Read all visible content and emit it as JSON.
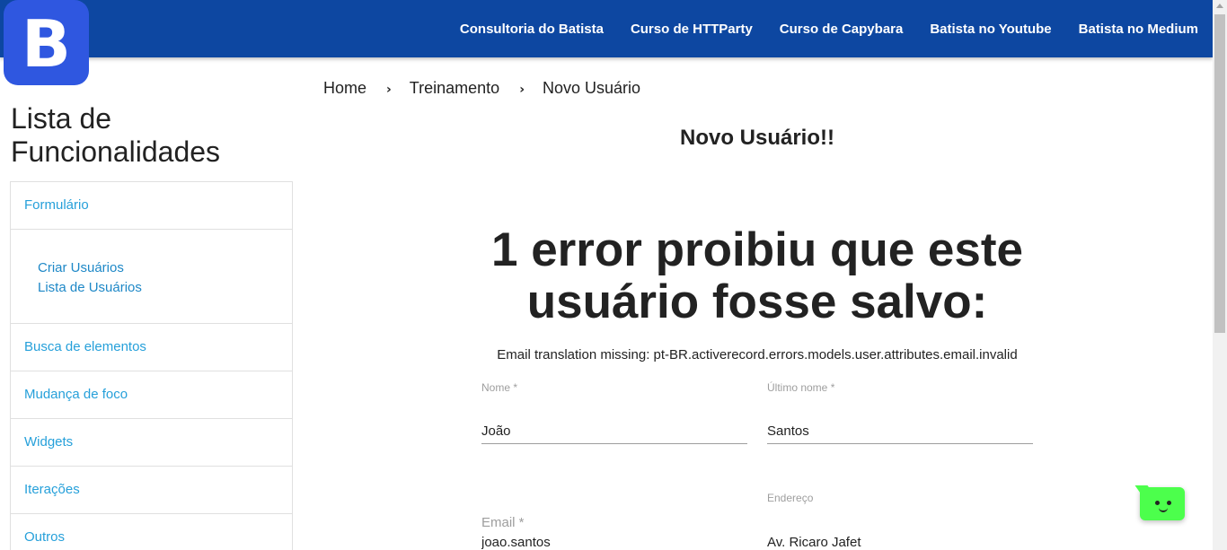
{
  "logo": {
    "letter": "B"
  },
  "nav": {
    "items": [
      "Consultoria do Batista",
      "Curso de HTTParty",
      "Curso de Capybara",
      "Batista no Youtube",
      "Batista no Medium"
    ]
  },
  "sidebar": {
    "title_line1": "Lista de",
    "title_line2": "Funcionalidades",
    "items": [
      {
        "label": "Formulário"
      },
      {
        "label": "Busca de elementos"
      },
      {
        "label": "Mudança de foco"
      },
      {
        "label": "Widgets"
      },
      {
        "label": "Iterações"
      },
      {
        "label": "Outros"
      }
    ],
    "sub_items": [
      "Criar Usuários",
      "Lista de Usuários"
    ]
  },
  "breadcrumb": {
    "items": [
      "Home",
      "Treinamento",
      "Novo Usuário"
    ],
    "separator": "›"
  },
  "main": {
    "title": "Novo Usuário!!",
    "error_title": "1 error proibiu que este usuário fosse salvo:",
    "error_message": "Email translation missing: pt-BR.activerecord.errors.models.user.attributes.email.invalid"
  },
  "form": {
    "nome": {
      "label": "Nome *",
      "value": "João"
    },
    "ultimo_nome": {
      "label": "Último nome *",
      "value": "Santos"
    },
    "email": {
      "label": "Email *",
      "value": "joao.santos"
    },
    "endereco": {
      "label": "Endereço",
      "value": "Av. Ricaro Jafet"
    }
  },
  "chat_widget": {
    "icon": "chat-bot-face-icon",
    "color": "#4cff4c"
  },
  "colors": {
    "nav_bg": "#0d47a1",
    "logo_bg": "#2f57e0",
    "link": "#26a0da"
  }
}
